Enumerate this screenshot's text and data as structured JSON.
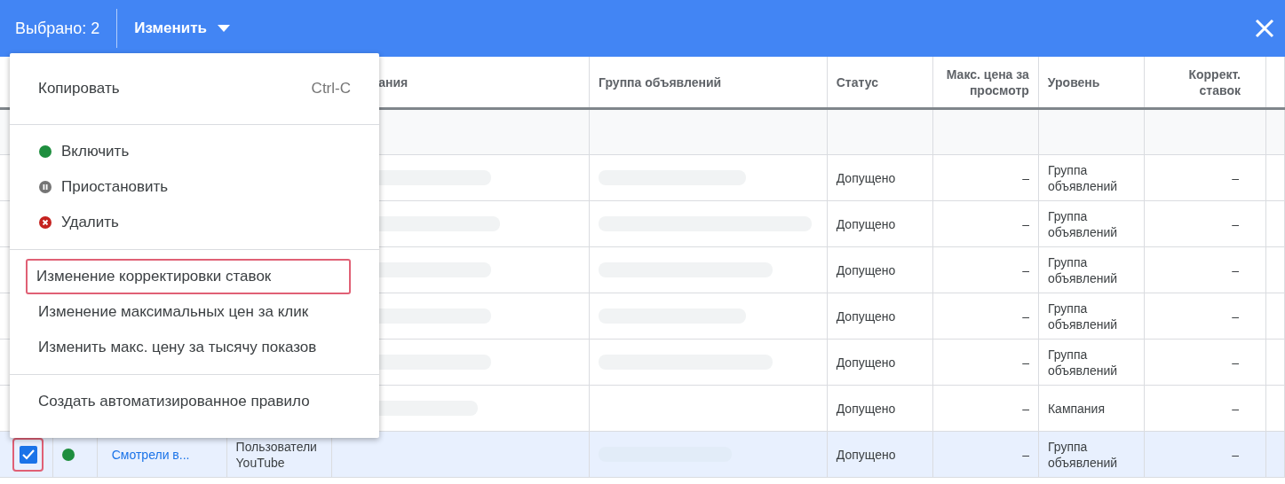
{
  "top_bar": {
    "selected_count": "Выбрано: 2",
    "edit_button": "Изменить"
  },
  "table": {
    "columns": [
      {
        "label": "ания"
      },
      {
        "label": "Группа объявлений"
      },
      {
        "label": "Статус"
      },
      {
        "label": "Макс. цена за просмотр",
        "kind": "numeric"
      },
      {
        "label": "Уровень"
      },
      {
        "label": "Коррект. ставок",
        "kind": "numeric"
      }
    ],
    "rows": [
      {
        "selected": false,
        "status": "Допущено",
        "max_price": "–",
        "level": "Группа объявлений",
        "bid_adjustment": "–"
      },
      {
        "selected": false,
        "status": "Допущено",
        "max_price": "–",
        "level": "Группа объявлений",
        "bid_adjustment": "–"
      },
      {
        "selected": false,
        "status": "Допущено",
        "max_price": "–",
        "level": "Группа объявлений",
        "bid_adjustment": "–"
      },
      {
        "selected": false,
        "status": "Допущено",
        "max_price": "–",
        "level": "Группа объявлений",
        "bid_adjustment": "–"
      },
      {
        "selected": false,
        "status": "Допущено",
        "max_price": "–",
        "level": "Группа объявлений",
        "bid_adjustment": "–"
      },
      {
        "selected": false,
        "status": "Допущено",
        "max_price": "–",
        "level": "Кампания",
        "bid_adjustment": "–"
      },
      {
        "selected": true,
        "checkbox": {
          "checked": true,
          "highlighted": true
        },
        "color": "#1e8e3e",
        "name": "Смотрели в...",
        "audience": "Пользователи YouTube",
        "status": "Допущено",
        "max_price": "–",
        "level": "Группа объявлений",
        "bid_adjustment": "–"
      }
    ]
  },
  "menu": {
    "sections": [
      [
        {
          "kind": "plain",
          "label": "Копировать",
          "shortcut": "Ctrl-C",
          "highlighted": false
        }
      ],
      [
        {
          "kind": "enable",
          "label": "Включить",
          "highlighted": false
        },
        {
          "kind": "pause",
          "label": "Приостановить",
          "highlighted": false
        },
        {
          "kind": "remove",
          "label": "Удалить",
          "highlighted": false
        }
      ],
      [
        {
          "kind": "plain",
          "label": "Изменение корректировки ставок",
          "highlighted": true
        },
        {
          "kind": "plain",
          "label": "Изменение максимальных цен за клик",
          "highlighted": false
        },
        {
          "kind": "plain",
          "label": "Изменить макс. цену за тысячу показов",
          "highlighted": false
        }
      ],
      [
        {
          "kind": "plain",
          "label": "Создать автоматизированное правило",
          "highlighted": false
        }
      ]
    ]
  }
}
